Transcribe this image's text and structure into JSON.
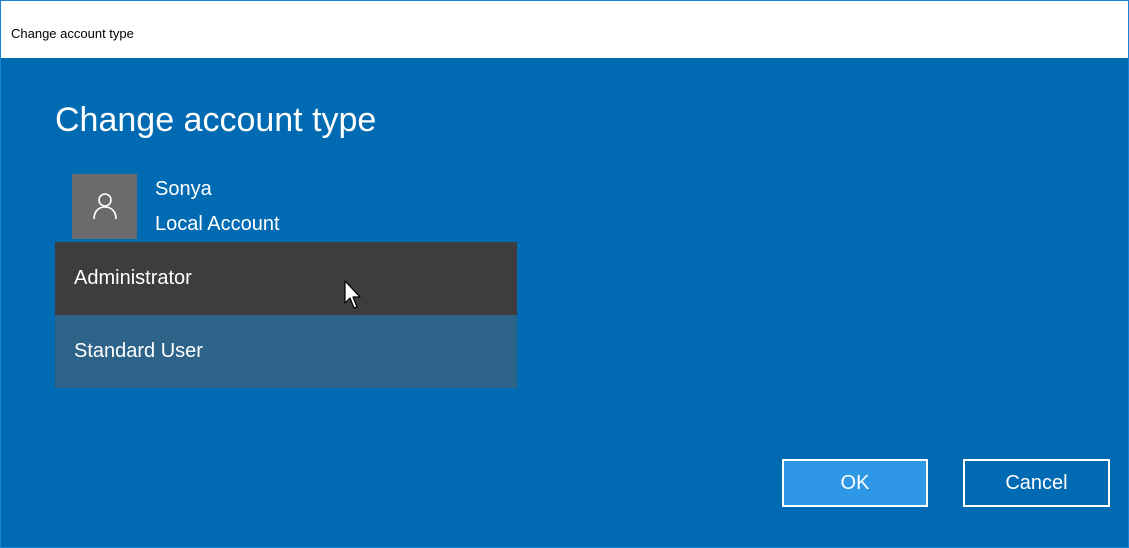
{
  "window": {
    "title": "Change account type"
  },
  "main": {
    "heading": "Change account type",
    "user": {
      "name": "Sonya",
      "account_type": "Local Account",
      "avatar_icon": "person-icon"
    },
    "dropdown": {
      "options": [
        {
          "label": "Administrator",
          "state": "hovered"
        },
        {
          "label": "Standard User",
          "state": "selected"
        }
      ]
    }
  },
  "buttons": {
    "ok_label": "OK",
    "cancel_label": "Cancel"
  },
  "colors": {
    "background": "#006ab2",
    "hover_option": "#3d3d3d",
    "selected_option": "#2d6289",
    "ok_button": "#2e97e6",
    "avatar": "#6b6b6b"
  }
}
